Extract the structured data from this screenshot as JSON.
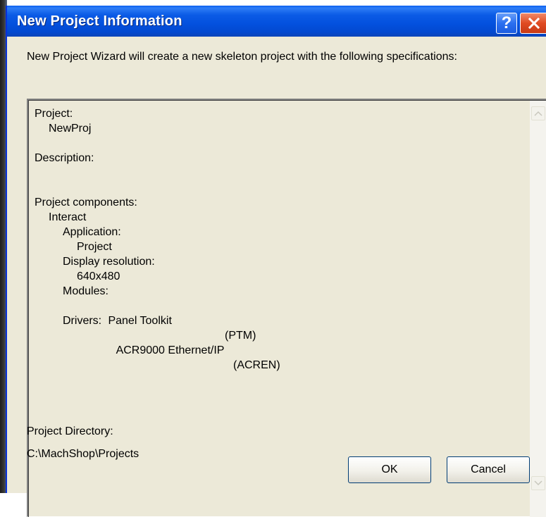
{
  "window": {
    "title": "New Project Information",
    "help_glyph": "?",
    "close_glyph": "✕"
  },
  "intro": "New Project Wizard will create a new skeleton project with the following specifications:",
  "summary": {
    "project_label": "Project:",
    "project_value": "NewProj",
    "description_label": "Description:",
    "components_label": "Project components:",
    "interact": "Interact",
    "application_label": "Application:",
    "application_value": "Project",
    "resolution_label": "Display resolution:",
    "resolution_value": "640x480",
    "modules_label": "Modules:",
    "module_name": "Panel Toolkit",
    "module_code": "(PTM)",
    "drivers_label": "Drivers:",
    "driver_name": "ACR9000 Ethernet/IP",
    "driver_code": "(ACREN)"
  },
  "project_directory": {
    "label": "Project Directory:",
    "path": "C:\\MachShop\\Projects"
  },
  "buttons": {
    "ok": "OK",
    "cancel": "Cancel"
  },
  "icons": {
    "help": "help-icon",
    "close": "close-icon",
    "scroll_up": "chevron-up-icon",
    "scroll_down": "chevron-down-icon"
  },
  "colors": {
    "titlebar": "#0350dd",
    "dialog_bg": "#ece9d8",
    "close_button": "#e04b22"
  }
}
